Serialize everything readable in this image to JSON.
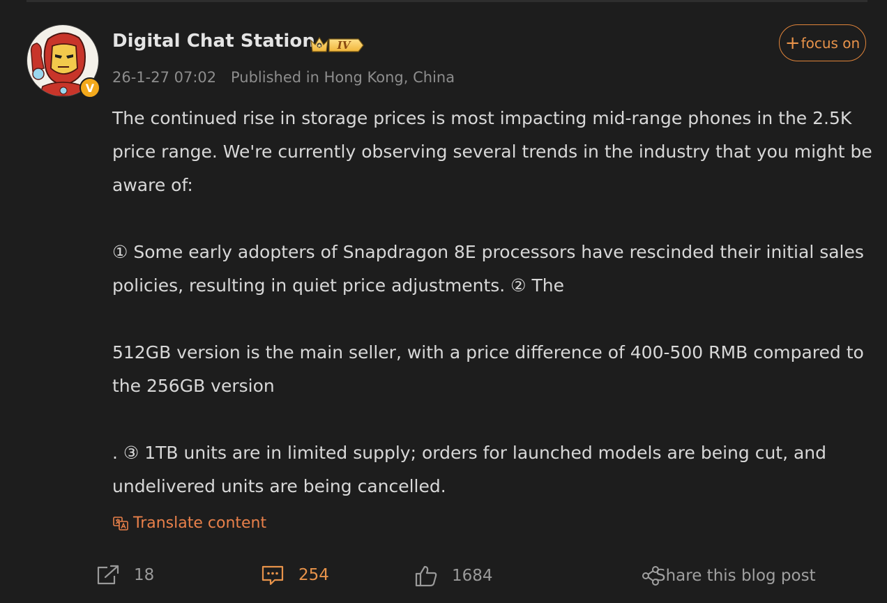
{
  "author": {
    "name": "Digital Chat Station",
    "level_badge": "IV",
    "avatar_icon": "iron-man-avatar",
    "verified_icon": "verified-v-badge"
  },
  "meta": {
    "time": "26-1-27 07:02",
    "location": "Published in Hong Kong, China"
  },
  "follow_button": {
    "plus": "+",
    "label": "focus on"
  },
  "post": {
    "paragraphs": [
      "The continued rise in storage prices is most impacting mid-range phones in the 2.5K price range. We're currently observing several trends in the industry that you might be aware of:",
      "① Some early adopters of Snapdragon 8E processors have rescinded their initial sales policies, resulting in quiet price adjustments. ② The",
      "512GB version is the main seller, with a price difference of 400-500 RMB compared to the 256GB version",
      ". ③ 1TB units are in limited supply; orders for launched models are being cut, and undelivered units are being cancelled."
    ]
  },
  "translate": {
    "label": "Translate content",
    "icon": "translate-icon"
  },
  "actions": {
    "repost_count": "18",
    "comment_count": "254",
    "like_count": "1684",
    "share_label": "Share this blog post"
  },
  "colors": {
    "background": "#1d1d1d",
    "accent": "#e8934a",
    "text": "#d8d8d8",
    "muted": "#8d8d8d"
  }
}
